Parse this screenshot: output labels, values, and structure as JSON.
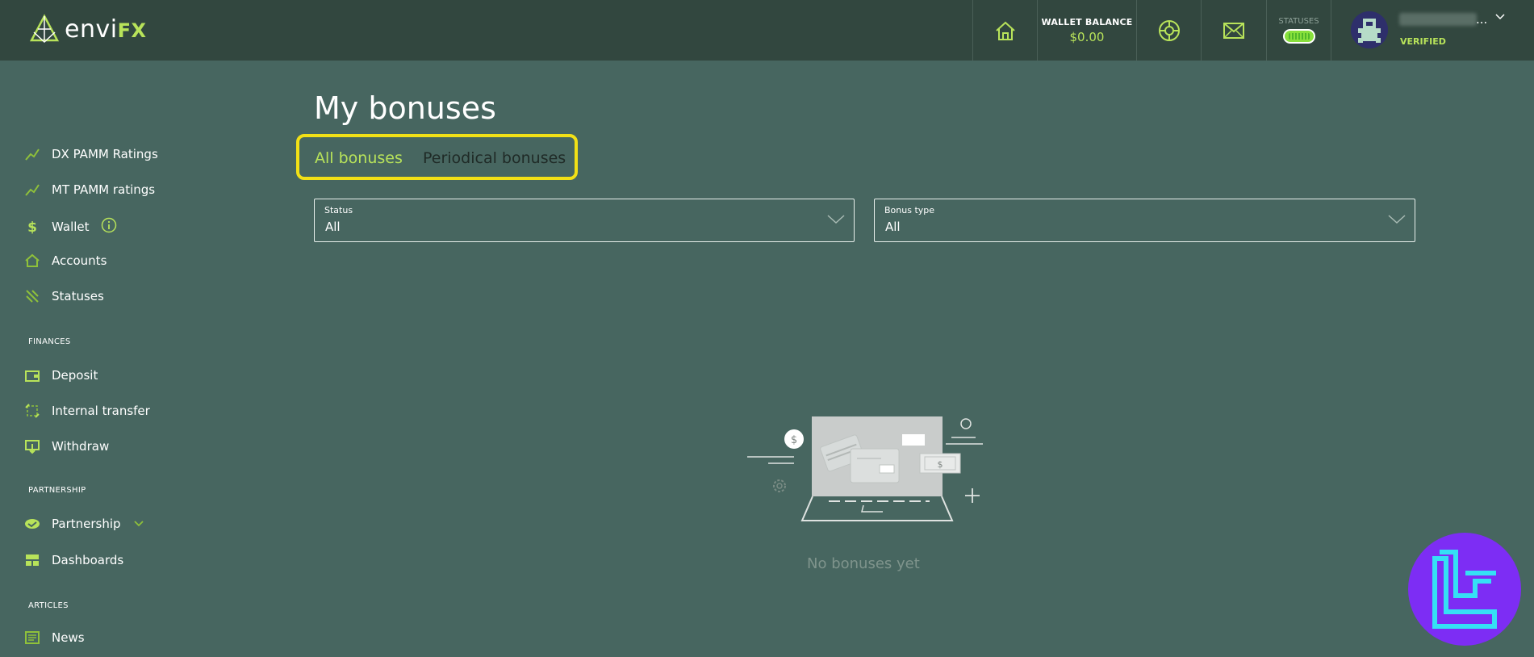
{
  "header": {
    "logo_text_main": "envi",
    "logo_text_accent": "FX",
    "wallet_label": "WALLET BALANCE",
    "wallet_value": "$0.00",
    "statuses_label": "STATUSES",
    "user_menu_dots": "...",
    "verified_label": "VERIFIED"
  },
  "sidebar": {
    "items": [
      {
        "label": "DX PAMM Ratings",
        "icon": "trend-line-icon"
      },
      {
        "label": "MT PAMM ratings",
        "icon": "trend-line-icon"
      },
      {
        "label": "Wallet",
        "icon": "dollar-icon"
      },
      {
        "label": "Accounts",
        "icon": "home-icon"
      },
      {
        "label": "Statuses",
        "icon": "statuses-icon"
      }
    ],
    "finances_title": "FINANCES",
    "finances": [
      {
        "label": "Deposit",
        "icon": "wallet-icon"
      },
      {
        "label": "Internal transfer",
        "icon": "transfer-icon"
      },
      {
        "label": "Withdraw",
        "icon": "withdraw-icon"
      }
    ],
    "partnership_title": "PARTNERSHIP",
    "partnership": [
      {
        "label": "Partnership",
        "icon": "handshake-icon"
      },
      {
        "label": "Dashboards",
        "icon": "dashboard-icon"
      }
    ],
    "articles_title": "ARTICLES",
    "articles": [
      {
        "label": "News",
        "icon": "news-icon"
      }
    ]
  },
  "main": {
    "title": "My bonuses",
    "tabs": [
      {
        "label": "All bonuses",
        "active": true
      },
      {
        "label": "Periodical bonuses",
        "active": false
      }
    ],
    "filters": {
      "status_label": "Status",
      "status_value": "All",
      "bonus_type_label": "Bonus type",
      "bonus_type_value": "All"
    },
    "empty_state": "No bonuses yet"
  },
  "colors": {
    "background": "#476660",
    "header": "#32473f",
    "accent": "#b8e35a",
    "highlight_border": "#f2e016",
    "watermark": "#7d2df4"
  }
}
